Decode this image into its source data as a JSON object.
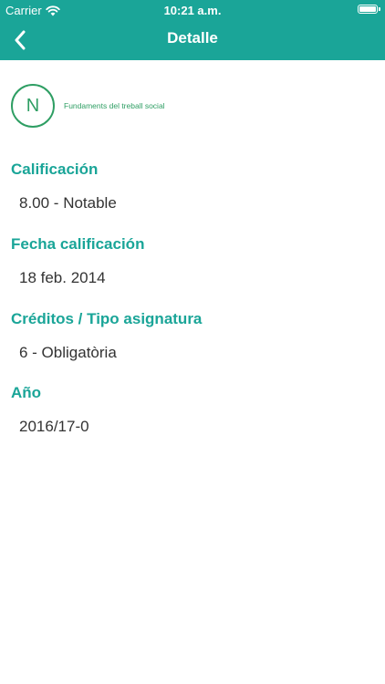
{
  "status_bar": {
    "carrier": "Carrier",
    "time": "10:21 a.m."
  },
  "nav": {
    "title": "Detalle",
    "back_icon": "chevron-left-icon"
  },
  "subject": {
    "initial": "N",
    "name": "Fundaments del treball social"
  },
  "details": [
    {
      "label": "Calificación",
      "value": "8.00 - Notable"
    },
    {
      "label": "Fecha calificación",
      "value": "18 feb. 2014"
    },
    {
      "label": "Créditos / Tipo asignatura",
      "value": "6 - Obligatòria"
    },
    {
      "label": "Año",
      "value": "2016/17-0"
    }
  ],
  "colors": {
    "accent": "#1aa598",
    "subject_green": "#2e9e63",
    "value_text": "#333333"
  }
}
